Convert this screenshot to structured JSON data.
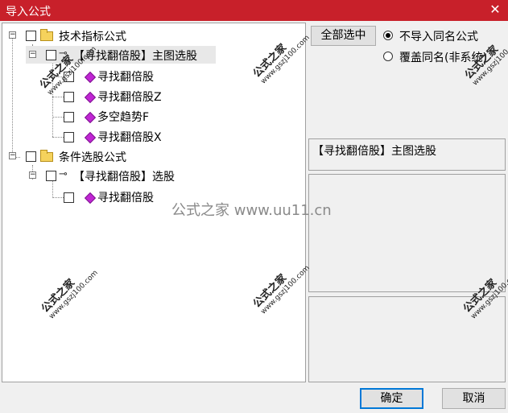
{
  "window": {
    "title": "导入公式",
    "close_glyph": "✕"
  },
  "tree": {
    "expander_minus": "−",
    "group1": {
      "label": "技术指标公式"
    },
    "sub1": {
      "label": "【寻找翻倍股】主图选股"
    },
    "items1": [
      "寻找翻倍股",
      "寻找翻倍股Z",
      "多空趋势F",
      "寻找翻倍股X"
    ],
    "group2": {
      "label": "条件选股公式"
    },
    "sub2": {
      "label": "【寻找翻倍股】选股"
    },
    "items2": [
      "寻找翻倍股"
    ],
    "key_glyph": "⊸"
  },
  "right": {
    "select_all": "全部选中",
    "radio1": "不导入同名公式",
    "radio2": "覆盖同名(非系统)",
    "info": "【寻找翻倍股】主图选股"
  },
  "buttons": {
    "ok": "确定",
    "cancel": "取消"
  },
  "watermark": {
    "logo": "公式之家",
    "url": "www.gszj100.com",
    "center": "公式之家 www.uu11.cn"
  }
}
